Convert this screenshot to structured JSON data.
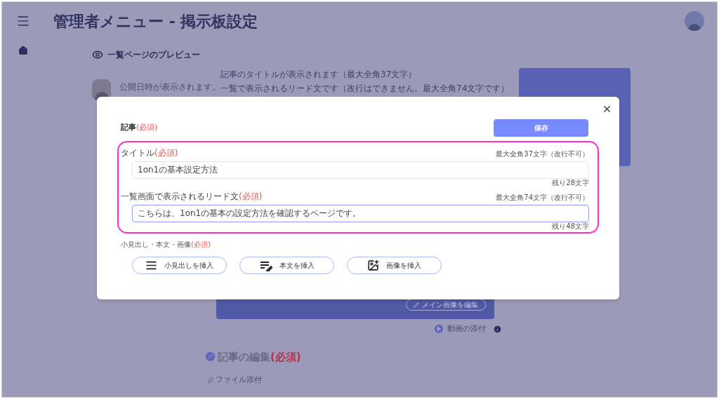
{
  "header": {
    "title": "管理者メニュー - 掲示板設定"
  },
  "preview": {
    "label": "一覧ページのプレビュー",
    "date": "公開日時が表示されます。",
    "title_text": "記事のタイトルが表示されます（最大全角37文字）",
    "lead_text": "一覧で表示されるリード文です（改行はできません。最大全角74文字です）"
  },
  "main_image": {
    "edit_button": "メイン画像を編集"
  },
  "video": {
    "label": "動画の添付"
  },
  "edit_section": {
    "title": "記事の編集",
    "required": "(必須)"
  },
  "attachment": {
    "label": "ファイル添付"
  },
  "dialog": {
    "title": "記事",
    "required": "(必須)",
    "save_button": "保存",
    "fields": [
      {
        "label": "タイトル",
        "required": "(必須)",
        "limit": "最大全角37文字（改行不可）",
        "value": "1on1の基本設定方法",
        "remaining": "残り28文字",
        "focused": false
      },
      {
        "label": "一覧画面で表示されるリード文",
        "required": "(必須)",
        "limit": "最大全角74文字（改行不可）",
        "value": "こちらは、1on1の基本の設定方法を確認するページです。",
        "remaining": "残り48文字",
        "focused": true
      }
    ],
    "content_label": "小見出し・本文・画像",
    "content_required": "(必須)",
    "insert_buttons": [
      {
        "kind": "heading",
        "label": "小見出しを挿入"
      },
      {
        "kind": "text",
        "label": "本文を挿入"
      },
      {
        "kind": "image",
        "label": "画像を挿入"
      }
    ]
  }
}
